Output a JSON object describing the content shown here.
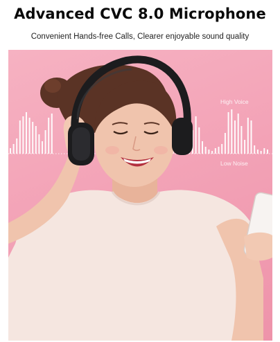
{
  "title": "Advanced CVC 8.0 Microphone",
  "subtitle": "Convenient Hands-free Calls, Clearer enjoyable sound quality",
  "labels": {
    "high": "High Voice",
    "low": "Low Noise"
  },
  "colors": {
    "background": "#f3a3b7",
    "headphones": "#1c1c1e",
    "shirt": "#f5e6e0",
    "hair": "#5a3325",
    "skin": "#f0c4ad"
  },
  "icons": [
    "waveform-icon",
    "headphones-icon",
    "smartphone-icon"
  ]
}
